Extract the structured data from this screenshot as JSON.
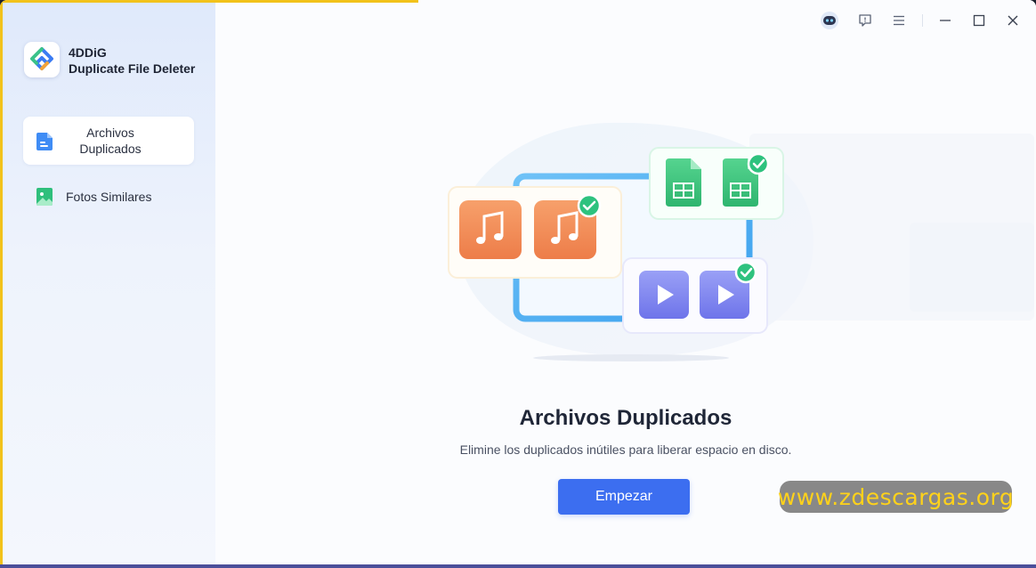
{
  "app": {
    "brand": "4DDiG",
    "product": "Duplicate File Deleter"
  },
  "sidebar": {
    "items": [
      {
        "label_line1": "Archivos",
        "label_line2": "Duplicados",
        "icon": "document-icon",
        "active": true
      },
      {
        "label": "Fotos Similares",
        "icon": "image-icon",
        "active": false
      }
    ]
  },
  "titlebar": {
    "icons": [
      "robot-assistant-icon",
      "feedback-icon",
      "menu-icon",
      "minimize-icon",
      "maximize-icon",
      "close-icon"
    ]
  },
  "main": {
    "heading": "Archivos Duplicados",
    "subtitle": "Elimine los duplicados inútiles para liberar espacio en disco.",
    "start_button": "Empezar"
  },
  "watermark": {
    "text": "www.zdescargas.org"
  },
  "colors": {
    "accent": "#3c6ef0",
    "sidebar_bg": "#e6eefb",
    "music_orange": "#f08a55",
    "sheet_green": "#3dc47e",
    "video_purple": "#7b82f2",
    "check_green": "#2ec27e",
    "watermark_text": "#ffd21a"
  }
}
